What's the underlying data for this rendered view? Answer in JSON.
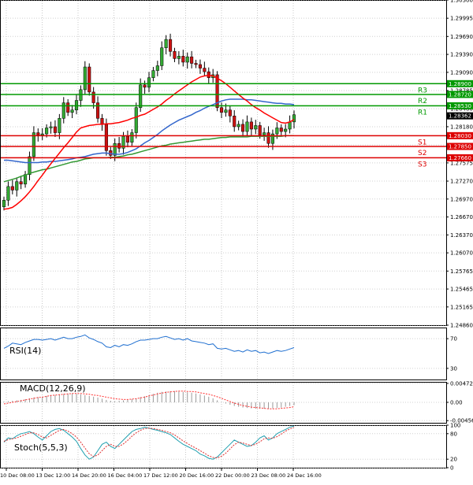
{
  "chart_data": [
    {
      "type": "candlestick",
      "panel": "price",
      "ylim": [
        1.2486,
        1.303
      ],
      "y_ticks": [
        "1.30300",
        "1.29995",
        "1.29690",
        "1.29390",
        "1.29090",
        "1.28785",
        "1.28480",
        "1.28180",
        "1.27875",
        "1.27575",
        "1.27270",
        "1.26970",
        "1.26670",
        "1.26370",
        "1.26070",
        "1.25765",
        "1.25465",
        "1.25165",
        "1.24860"
      ],
      "x_ticks": [
        "10 Dec 08:00",
        "13 Dec 12:00",
        "14 Dec 20:00",
        "16 Dec 04:00",
        "17 Dec 12:00",
        "20 Dec 16:00",
        "22 Dec 00:00",
        "23 Dec 08:00",
        "24 Dec 16:00"
      ],
      "current_price": "1.28362",
      "levels": [
        {
          "label": "R3",
          "value": 1.289,
          "price_label": "1.28900",
          "color": "#009900"
        },
        {
          "label": "R2",
          "value": 1.2872,
          "price_label": "1.28720",
          "color": "#009900"
        },
        {
          "label": "R1",
          "value": 1.2853,
          "price_label": "1.28530",
          "color": "#009900"
        },
        {
          "label": "S1",
          "value": 1.2803,
          "price_label": "1.28030",
          "color": "#dd0000"
        },
        {
          "label": "S2",
          "value": 1.2785,
          "price_label": "1.27850",
          "color": "#dd0000"
        },
        {
          "label": "S3",
          "value": 1.2766,
          "price_label": "1.27660",
          "color": "#dd0000"
        }
      ],
      "closes": [
        1.2695,
        1.2718,
        1.2712,
        1.2726,
        1.2722,
        1.2738,
        1.2768,
        1.2808,
        1.2804,
        1.2806,
        1.2816,
        1.2818,
        1.2808,
        1.2832,
        1.2858,
        1.2842,
        1.2846,
        1.2862,
        1.288,
        1.2918,
        1.2876,
        1.2858,
        1.2832,
        1.2822,
        1.2778,
        1.277,
        1.279,
        1.2782,
        1.2802,
        1.2792,
        1.2808,
        1.285,
        1.2888,
        1.2884,
        1.29,
        1.2912,
        1.292,
        1.295,
        1.2964,
        1.2944,
        1.2932,
        1.2936,
        1.2926,
        1.2935,
        1.2924,
        1.2922,
        1.2916,
        1.291,
        1.29,
        1.2905,
        1.285,
        1.2842,
        1.2846,
        1.2836,
        1.2818,
        1.2822,
        1.281,
        1.2826,
        1.2814,
        1.282,
        1.2804,
        1.2808,
        1.279,
        1.2806,
        1.2816,
        1.281,
        1.2814,
        1.2826,
        1.2838
      ],
      "sma_red": {
        "color": "#ff0000",
        "values": [
          1.268,
          1.2681,
          1.2683,
          1.2688,
          1.2694,
          1.2701,
          1.2709,
          1.2718,
          1.2728,
          1.2737,
          1.2747,
          1.2756,
          1.2765,
          1.2774,
          1.2783,
          1.2791,
          1.28,
          1.2809,
          1.2816,
          1.2818,
          1.282,
          1.2821,
          1.2822,
          1.2822,
          1.2823,
          1.2823,
          1.2824,
          1.2825,
          1.2827,
          1.2829,
          1.2832,
          1.2834,
          1.2837,
          1.2839,
          1.2843,
          1.2847,
          1.2851,
          1.2856,
          1.2862,
          1.2867,
          1.2873,
          1.2878,
          1.2883,
          1.2888,
          1.2893,
          1.2897,
          1.2901,
          1.2903,
          1.2904,
          1.2903,
          1.2899,
          1.2895,
          1.289,
          1.2884,
          1.2878,
          1.2872,
          1.2866,
          1.2861,
          1.2855,
          1.285,
          1.2846,
          1.2841,
          1.2837,
          1.2833,
          1.2829,
          1.2825,
          1.2824,
          1.2826,
          1.283
        ]
      },
      "sma_blue": {
        "color": "#3366cc",
        "values": [
          1.2762,
          1.2762,
          1.2761,
          1.276,
          1.2759,
          1.2758,
          1.2758,
          1.2758,
          1.2758,
          1.2759,
          1.2759,
          1.276,
          1.276,
          1.2761,
          1.2762,
          1.2763,
          1.2764,
          1.2766,
          1.2767,
          1.2768,
          1.277,
          1.2772,
          1.2773,
          1.2774,
          1.2774,
          1.2773,
          1.2772,
          1.2772,
          1.2773,
          1.2775,
          1.2778,
          1.2781,
          1.2786,
          1.2791,
          1.2795,
          1.28,
          1.2805,
          1.2811,
          1.2816,
          1.2821,
          1.2825,
          1.2829,
          1.2832,
          1.2835,
          1.2838,
          1.2842,
          1.2845,
          1.2849,
          1.2852,
          1.2855,
          1.2858,
          1.2861,
          1.2863,
          1.2864,
          1.2864,
          1.2864,
          1.2864,
          1.2863,
          1.2863,
          1.2862,
          1.2861,
          1.286,
          1.2859,
          1.2858,
          1.2857,
          1.2857,
          1.2856,
          1.2856,
          1.2855
        ]
      },
      "sma_green": {
        "color": "#339933",
        "values": [
          1.2726,
          1.2728,
          1.273,
          1.2732,
          1.2735,
          1.2737,
          1.274,
          1.2742,
          1.2744,
          1.2746,
          1.2747,
          1.2749,
          1.2751,
          1.2753,
          1.2755,
          1.2757,
          1.2759,
          1.276,
          1.2762,
          1.2764,
          1.2765,
          1.2766,
          1.2766,
          1.2766,
          1.2766,
          1.2767,
          1.2767,
          1.2768,
          1.2769,
          1.2771,
          1.2772,
          1.2774,
          1.2776,
          1.2778,
          1.278,
          1.2782,
          1.2784,
          1.2786,
          1.2787,
          1.2789,
          1.279,
          1.2791,
          1.2792,
          1.2793,
          1.2794,
          1.2795,
          1.2796,
          1.2797,
          1.2797,
          1.2798,
          1.2799,
          1.28,
          1.28,
          1.2801,
          1.2801,
          1.2801,
          1.2801,
          1.2801,
          1.2802,
          1.2802,
          1.2802,
          1.2802,
          1.2802,
          1.2802,
          1.2802,
          1.2802,
          1.2803,
          1.2803,
          1.2803
        ]
      }
    },
    {
      "type": "line",
      "panel": "rsi",
      "label": "RSI(14)",
      "ylim": [
        15,
        85
      ],
      "y_ticks": [
        {
          "v": 70,
          "t": "70"
        },
        {
          "v": 30,
          "t": "30"
        }
      ],
      "series": [
        {
          "color": "#1f6fd0",
          "values": [
            57,
            60,
            64,
            63,
            62,
            65,
            67,
            69,
            69,
            68,
            69,
            70,
            68,
            70,
            72,
            70,
            70,
            72,
            73,
            75,
            71,
            69,
            66,
            64,
            59,
            58,
            61,
            59,
            62,
            61,
            63,
            66,
            68,
            68,
            69,
            70,
            70,
            72,
            73,
            71,
            69,
            70,
            68,
            70,
            67,
            66,
            65,
            64,
            62,
            63,
            57,
            56,
            57,
            55,
            53,
            54,
            52,
            55,
            53,
            54,
            51,
            52,
            50,
            52,
            54,
            53,
            54,
            56,
            58
          ]
        }
      ]
    },
    {
      "type": "bar+line",
      "panel": "macd",
      "label": "MACD(12,26,9)",
      "ylim": [
        -0.0051,
        0.0051
      ],
      "y_ticks": [
        {
          "v": 0.00472,
          "t": "0.00472"
        },
        {
          "v": 0,
          "t": "0.00"
        },
        {
          "v": -0.00456,
          "t": "-0.00456"
        }
      ],
      "histogram": [
        0.0002,
        0.0003,
        0.0004,
        0.0005,
        0.0006,
        0.0008,
        0.001,
        0.0012,
        0.0013,
        0.0014,
        0.0016,
        0.0018,
        0.0018,
        0.0019,
        0.0021,
        0.0022,
        0.0022,
        0.0021,
        0.002,
        0.0018,
        0.0016,
        0.0014,
        0.0012,
        0.0009,
        0.0006,
        0.0004,
        0.0003,
        0.0004,
        0.0005,
        0.0006,
        0.0008,
        0.001,
        0.0013,
        0.0015,
        0.0018,
        0.0021,
        0.0024,
        0.0026,
        0.0027,
        0.0028,
        0.0028,
        0.0027,
        0.0026,
        0.0025,
        0.0024,
        0.0022,
        0.002,
        0.0017,
        0.0014,
        0.001,
        0.0005,
        0.0001,
        -0.0003,
        -0.0006,
        -0.0009,
        -0.0011,
        -0.0013,
        -0.0014,
        -0.0015,
        -0.0016,
        -0.0016,
        -0.0016,
        -0.0016,
        -0.0015,
        -0.0014,
        -0.0013,
        -0.0011,
        -0.0009,
        -0.0007
      ],
      "signal": {
        "color": "#ff3333",
        "values": [
          -0.0004,
          -0.0002,
          0.0,
          0.0002,
          0.0004,
          0.0006,
          0.0008,
          0.001,
          0.0012,
          0.0013,
          0.0015,
          0.0017,
          0.0018,
          0.0019,
          0.002,
          0.0021,
          0.0022,
          0.0022,
          0.0022,
          0.0021,
          0.002,
          0.0018,
          0.0017,
          0.0015,
          0.0013,
          0.0011,
          0.0009,
          0.0008,
          0.0007,
          0.0007,
          0.0008,
          0.0009,
          0.0011,
          0.0013,
          0.0016,
          0.0018,
          0.0021,
          0.0023,
          0.0025,
          0.0026,
          0.0027,
          0.0028,
          0.0028,
          0.0027,
          0.0027,
          0.0026,
          0.0024,
          0.0022,
          0.002,
          0.0017,
          0.0014,
          0.001,
          0.0006,
          0.0002,
          -0.0002,
          -0.0005,
          -0.0008,
          -0.001,
          -0.0012,
          -0.0013,
          -0.0014,
          -0.0015,
          -0.0016,
          -0.0016,
          -0.0016,
          -0.0015,
          -0.0014,
          -0.0013,
          -0.0011
        ]
      }
    },
    {
      "type": "line",
      "panel": "stoch",
      "label": "Stoch(5,5,3)",
      "ylim": [
        0,
        100
      ],
      "y_ticks": [
        {
          "v": 100,
          "t": "100"
        },
        {
          "v": 80,
          "t": "80"
        },
        {
          "v": 20,
          "t": "20"
        },
        {
          "v": 0,
          "t": "0"
        }
      ],
      "series": [
        {
          "color": "#20a0b0",
          "values": [
            60,
            70,
            68,
            75,
            80,
            82,
            85,
            80,
            72,
            65,
            75,
            85,
            90,
            92,
            88,
            80,
            72,
            62,
            45,
            30,
            20,
            25,
            40,
            55,
            60,
            50,
            45,
            55,
            65,
            75,
            85,
            90,
            92,
            95,
            93,
            90,
            88,
            85,
            82,
            78,
            70,
            62,
            55,
            50,
            45,
            40,
            32,
            28,
            22,
            20,
            25,
            35,
            45,
            55,
            65,
            60,
            55,
            50,
            52,
            60,
            70,
            75,
            65,
            70,
            80,
            85,
            90,
            95,
            98
          ]
        },
        {
          "color": "#e03030",
          "values": [
            62,
            66,
            68,
            70,
            74,
            78,
            82,
            82,
            78,
            72,
            70,
            76,
            82,
            88,
            90,
            86,
            80,
            72,
            60,
            46,
            33,
            26,
            30,
            40,
            50,
            55,
            50,
            50,
            56,
            64,
            74,
            82,
            88,
            92,
            93,
            92,
            90,
            88,
            85,
            82,
            77,
            70,
            63,
            57,
            51,
            46,
            40,
            34,
            28,
            24,
            23,
            27,
            34,
            44,
            54,
            60,
            58,
            55,
            52,
            55,
            61,
            68,
            70,
            69,
            73,
            79,
            86,
            91,
            95
          ]
        }
      ]
    }
  ]
}
